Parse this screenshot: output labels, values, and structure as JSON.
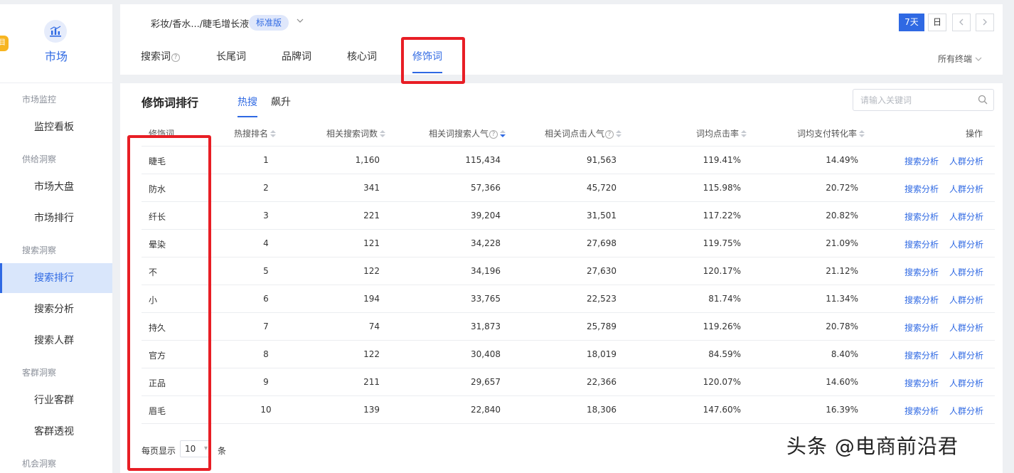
{
  "sidebar": {
    "tag": "目",
    "module_title": "市场",
    "groups": [
      {
        "label": "市场监控"
      },
      {
        "label": "供给洞察"
      },
      {
        "label": "搜索洞察"
      },
      {
        "label": "客群洞察"
      },
      {
        "label": "机会洞察"
      }
    ],
    "items": [
      {
        "label": "监控看板"
      },
      {
        "label": "市场大盘"
      },
      {
        "label": "市场排行"
      },
      {
        "label": "搜索排行",
        "active": true
      },
      {
        "label": "搜索分析"
      },
      {
        "label": "搜索人群"
      },
      {
        "label": "行业客群"
      },
      {
        "label": "客群透视"
      }
    ]
  },
  "header": {
    "breadcrumb": "彩妆/香水.../睫毛增长液",
    "version_badge": "标准版",
    "period_buttons": [
      "7天",
      "日"
    ],
    "active_period": "7天",
    "terminal_select": "所有终端"
  },
  "tabs": [
    {
      "label": "搜索词",
      "help": true
    },
    {
      "label": "长尾词"
    },
    {
      "label": "品牌词"
    },
    {
      "label": "核心词"
    },
    {
      "label": "修饰词",
      "active": true
    }
  ],
  "ranking": {
    "title": "修饰词排行",
    "sub_tabs": [
      "热搜",
      "飙升"
    ],
    "active_sub_tab": "热搜",
    "search_placeholder": "请输入关键词"
  },
  "table": {
    "columns": [
      "修饰词",
      "热搜排名",
      "相关搜索词数",
      "相关词搜索人气",
      "相关词点击人气",
      "词均点击率",
      "词均支付转化率",
      "操作"
    ],
    "rows": [
      {
        "word": "睫毛",
        "rank": "1",
        "related": "1,160",
        "search_pop": "115,434",
        "click_pop": "91,563",
        "ctr": "119.41%",
        "cvr": "14.49%"
      },
      {
        "word": "防水",
        "rank": "2",
        "related": "341",
        "search_pop": "57,366",
        "click_pop": "45,720",
        "ctr": "115.98%",
        "cvr": "20.72%"
      },
      {
        "word": "纤长",
        "rank": "3",
        "related": "221",
        "search_pop": "39,204",
        "click_pop": "31,501",
        "ctr": "117.22%",
        "cvr": "20.82%"
      },
      {
        "word": "晕染",
        "rank": "4",
        "related": "121",
        "search_pop": "34,228",
        "click_pop": "27,698",
        "ctr": "119.75%",
        "cvr": "21.09%"
      },
      {
        "word": "不",
        "rank": "5",
        "related": "122",
        "search_pop": "34,196",
        "click_pop": "27,630",
        "ctr": "120.17%",
        "cvr": "21.12%"
      },
      {
        "word": "小",
        "rank": "6",
        "related": "194",
        "search_pop": "33,765",
        "click_pop": "22,523",
        "ctr": "81.74%",
        "cvr": "11.34%"
      },
      {
        "word": "持久",
        "rank": "7",
        "related": "74",
        "search_pop": "31,873",
        "click_pop": "25,789",
        "ctr": "119.26%",
        "cvr": "20.78%"
      },
      {
        "word": "官方",
        "rank": "8",
        "related": "122",
        "search_pop": "30,408",
        "click_pop": "18,019",
        "ctr": "84.59%",
        "cvr": "8.40%"
      },
      {
        "word": "正品",
        "rank": "9",
        "related": "211",
        "search_pop": "29,657",
        "click_pop": "22,366",
        "ctr": "120.07%",
        "cvr": "14.60%"
      },
      {
        "word": "眉毛",
        "rank": "10",
        "related": "139",
        "search_pop": "22,840",
        "click_pop": "18,306",
        "ctr": "147.60%",
        "cvr": "16.39%"
      }
    ],
    "actions": [
      "搜索分析",
      "人群分析"
    ]
  },
  "pagination": {
    "per_page_label": "每页显示",
    "per_page_value": "10",
    "unit": "条"
  },
  "watermark": "头条 @电商前沿君",
  "colors": {
    "accent": "#2f69e3",
    "highlight_box": "#e81e25"
  },
  "icons": {
    "module": "bar-chart-icon",
    "search": "search-icon"
  }
}
